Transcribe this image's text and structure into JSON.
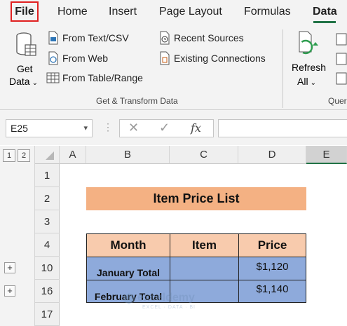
{
  "ribbon_tabs": [
    "File",
    "Home",
    "Insert",
    "Page Layout",
    "Formulas",
    "Data"
  ],
  "ribbon": {
    "get_data_line1": "Get",
    "get_data_line2": "Data",
    "from_text_csv": "From Text/CSV",
    "from_web": "From Web",
    "from_table_range": "From Table/Range",
    "recent_sources": "Recent Sources",
    "existing_connections": "Existing Connections",
    "refresh_line1": "Refresh",
    "refresh_line2": "All",
    "group_get_transform": "Get & Transform Data",
    "group_queries_partial": "Quer"
  },
  "formula_bar": {
    "name_box": "E25",
    "fx": "fx",
    "formula": ""
  },
  "outline_levels": [
    "1",
    "2"
  ],
  "columns": [
    "A",
    "B",
    "C",
    "D",
    "E"
  ],
  "rows": [
    "1",
    "2",
    "3",
    "4",
    "10",
    "16",
    "17"
  ],
  "sheet": {
    "title": "Item Price List",
    "headers": [
      "Month",
      "Item",
      "Price"
    ],
    "data": [
      {
        "month": "January Total",
        "item": "",
        "price": "$1,120"
      },
      {
        "month": "February Total",
        "item": "",
        "price": "$1,140"
      }
    ]
  },
  "watermark": {
    "brand": "exceldemy",
    "tagline": "EXCEL · DATA · BI"
  },
  "colors": {
    "title_fill": "#f4b183",
    "header_fill": "#f8cbad",
    "data_fill": "#8eaadb",
    "accent": "#217346",
    "file_highlight": "#e02020"
  }
}
